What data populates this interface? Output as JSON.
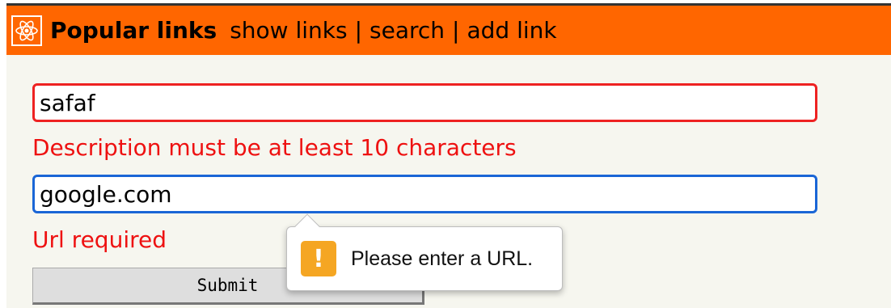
{
  "header": {
    "logo_icon": "react-atom-icon",
    "title": "Popular links",
    "nav": [
      {
        "label": "show links"
      },
      {
        "label": "search"
      },
      {
        "label": "add link"
      }
    ],
    "separator": "|",
    "bg_color": "#ff6600"
  },
  "form": {
    "description": {
      "value": "safaf",
      "error": "Description must be at least 10 characters",
      "border_color": "#ee2222"
    },
    "url": {
      "value": "google.com",
      "error": "Url required",
      "border_color": "#1a66d6"
    },
    "submit_label": "Submit",
    "error_color": "#ee1111"
  },
  "validation_tooltip": {
    "icon": "warning-icon",
    "icon_glyph": "!",
    "message": "Please enter a URL.",
    "icon_color": "#f5a623"
  }
}
